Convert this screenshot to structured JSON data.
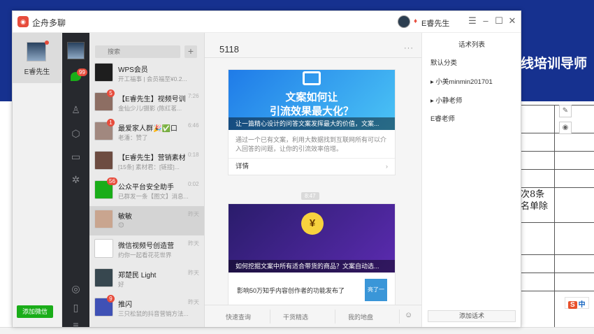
{
  "background": {
    "slide_title": "线培训导师",
    "slide_text_line1": "次8条",
    "slide_text_line2": "名单除",
    "sogou_label": "中"
  },
  "window": {
    "app_name": "企舟多聊",
    "user_name": "E睿先生",
    "controls": [
      "☰",
      "–",
      "☐",
      "✕"
    ]
  },
  "accounts": {
    "current_name": "E睿先生",
    "add_button": "添加微信"
  },
  "nav": {
    "unread_badge": "99"
  },
  "chat_list": {
    "search_placeholder": "搜索",
    "items": [
      {
        "name": "WPS会员",
        "preview": "开工福事 | 会员福至¥0.2...",
        "time": "",
        "badge": "",
        "avatar_color": "#1e1e1e"
      },
      {
        "name": "【E睿先生】视频号训...",
        "preview": "金仙少儿/摄影 (陈红茗...",
        "time": "7:26",
        "badge": "5",
        "avatar_color": "#8d6e63"
      },
      {
        "name": "最爱家人群🎉✅口",
        "preview": "老潘：赞了",
        "time": "6:46",
        "badge": "1",
        "avatar_color": "#a1887f"
      },
      {
        "name": "【E睿先生】营销素材...",
        "preview": "[15条] 素材君：[链接]...",
        "time": "0:18",
        "badge": "",
        "avatar_color": "#6d4c41"
      },
      {
        "name": "公众平台安全助手",
        "preview": "已群发一条【图文】消息...",
        "time": "0:02",
        "badge": "56",
        "avatar_color": "#1aad19"
      },
      {
        "name": "敏敏",
        "preview": "😊",
        "time": "昨天",
        "badge": "",
        "avatar_color": "#c9a58f"
      },
      {
        "name": "微信视频号创造营",
        "preview": "约你一起看花花世界",
        "time": "昨天",
        "badge": "",
        "avatar_color": "#ffffff"
      },
      {
        "name": "郑楚民 Light",
        "preview": "好",
        "time": "昨天",
        "badge": "",
        "avatar_color": "#37474f"
      },
      {
        "name": "推闪",
        "preview": "三只松鼠的抖音营销方法...",
        "time": "昨天",
        "badge": "9",
        "avatar_color": "#3f51b5"
      }
    ]
  },
  "chat": {
    "title": "5118",
    "card1": {
      "banner_line1": "文案如何让",
      "banner_line2": "引流效果最大化？",
      "caption": "让一篇精心设计的问答文案发挥最大的价值，文案...",
      "desc": "通过一个已有文案，利用大数据找到互联网所有可以介入回答的问题，让你的引流效率倍增。",
      "link_label": "详情"
    },
    "time_tag": "8:47",
    "card2": {
      "caption": "如何挖掘文案中所有适合带货的商品？文案自动选...",
      "sub_text": "影响50万知乎内容创作者的功能发布了",
      "sub_thumb": "亮了一"
    },
    "quick_actions": [
      "快速查询",
      "干货精选",
      "我的地盘"
    ]
  },
  "right_panel": {
    "title": "话术列表",
    "items": [
      "默认分类",
      "小美minmin201701",
      "小静老师",
      "E睿老师"
    ],
    "add_button": "添加话术"
  }
}
